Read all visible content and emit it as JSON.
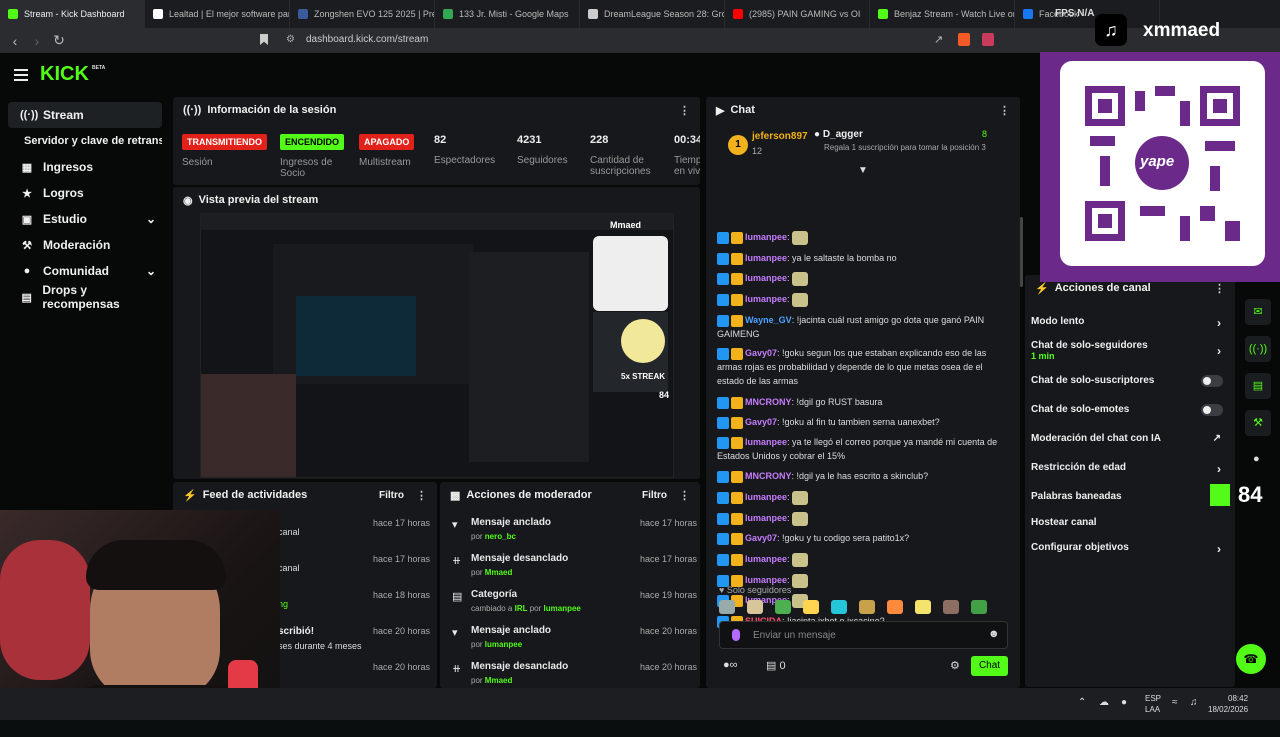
{
  "browser": {
    "tabs": [
      {
        "label": "Stream - Kick Dashboard",
        "color": "#53fc18"
      },
      {
        "label": "Lealtad | El mejor software para",
        "color": "#ffffff"
      },
      {
        "label": "Zongshen EVO 125 2025 | Prec",
        "color": "#3a5a9a"
      },
      {
        "label": "133 Jr. Misti - Google Maps",
        "color": "#34a853"
      },
      {
        "label": "DreamLeague Season 28: Grou",
        "color": "#cccccc"
      },
      {
        "label": "(2985) PAIN GAMING vs OI",
        "color": "#ff0000"
      },
      {
        "label": "Benjaz Stream - Watch Live on",
        "color": "#53fc18"
      },
      {
        "label": "Facebook",
        "color": "#1877f2"
      }
    ],
    "url": "dashboard.kick.com/stream",
    "fps": "FPS",
    "fps_val": "N/A"
  },
  "overlay": {
    "tiktok_name": "xmmaed",
    "yape": "yape",
    "kick_badge": "84"
  },
  "sidebar": {
    "logo": "KICK",
    "beta": "BETA",
    "items": [
      {
        "label": "Stream",
        "icon": "stream-icon"
      },
      {
        "label": "Servidor y clave de retransmisión",
        "icon": ""
      },
      {
        "label": "Ingresos",
        "icon": "money-icon"
      },
      {
        "label": "Logros",
        "icon": "trophy-icon"
      },
      {
        "label": "Estudio",
        "icon": "studio-icon"
      },
      {
        "label": "Moderación",
        "icon": "wrench-icon"
      },
      {
        "label": "Comunidad",
        "icon": "people-icon"
      },
      {
        "label": "Drops y recompensas",
        "icon": "gift-icon"
      }
    ]
  },
  "session": {
    "title": "Información de la sesión",
    "badges": [
      {
        "label": "TRANSMITIENDO",
        "sub": "Sesión",
        "bg": "#e1211a",
        "fg": "#ffffff"
      },
      {
        "label": "ENCENDIDO",
        "sub": "Ingresos de Socio",
        "bg": "#53fc18",
        "fg": "#000000"
      },
      {
        "label": "APAGADO",
        "sub": "Multistream",
        "bg": "#e1211a",
        "fg": "#ffffff"
      }
    ],
    "stats": [
      {
        "value": "82",
        "label": "Espectadores"
      },
      {
        "value": "4231",
        "label": "Seguidores"
      },
      {
        "value": "228",
        "label": "Cantidad de suscripciones"
      },
      {
        "value": "00:34:",
        "label": "Tiempo en vivo"
      }
    ]
  },
  "preview": {
    "title": "Vista previa del stream",
    "streak": "5x STREAK",
    "streak_name": "Mmaed",
    "streak_count": "84"
  },
  "feed": {
    "title": "Feed de actividades",
    "filter": "Filtro",
    "rows": [
      {
        "text": "canal",
        "time": "hace 17 horas"
      },
      {
        "text": "canal",
        "time": "hace 17 horas"
      },
      {
        "text": "ng",
        "time": "hace 18 horas"
      },
      {
        "text": "scribió!",
        "sub": "ses durante 4 meses",
        "time": "hace 20 horas"
      },
      {
        "text": "",
        "time": "hace 20 horas"
      }
    ]
  },
  "modactions": {
    "title": "Acciones de moderador",
    "filter": "Filtro",
    "rows": [
      {
        "title": "Mensaje anclado",
        "by": "por",
        "user": "nero_bc",
        "time": "hace 17 horas",
        "icon": "pin-icon"
      },
      {
        "title": "Mensaje desanclado",
        "by": "por",
        "user": "Mmaed",
        "time": "hace 17 horas",
        "icon": "unpin-icon"
      },
      {
        "title": "Categoría",
        "by": "cambiado a",
        "user": "IRL",
        "by2": "por",
        "user2": "lumanpee",
        "time": "hace 19 horas",
        "icon": "category-icon"
      },
      {
        "title": "Mensaje anclado",
        "by": "por",
        "user": "lumanpee",
        "time": "hace 20 horas",
        "icon": "pin-icon"
      },
      {
        "title": "Mensaje desanclado",
        "by": "por",
        "user": "Mmaed",
        "time": "hace 20 horas",
        "icon": "unpin-icon"
      }
    ]
  },
  "chat": {
    "title": "Chat",
    "top_user": "jeferson897",
    "top_rank": "1",
    "top_count": "12",
    "gifter": "D_agger",
    "gifter_count": "8",
    "gifter_msg": "Regala 1 suscripción para tomar la posición 3",
    "messages": [
      {
        "user": "lumanpee",
        "color": "#c77dff",
        "text": "",
        "emote": true
      },
      {
        "user": "lumanpee",
        "color": "#c77dff",
        "text": "ya le saltaste la bomba no"
      },
      {
        "user": "lumanpee",
        "color": "#c77dff",
        "text": "",
        "emote": true
      },
      {
        "user": "lumanpee",
        "color": "#c77dff",
        "text": "",
        "emote": true
      },
      {
        "user": "Wayne_GV",
        "color": "#4aa3ff",
        "text": "!jacinta cuál rust amigo go dota que ganó PAIN GAIMENG"
      },
      {
        "user": "Gavy07",
        "color": "#c77dff",
        "text": "!goku segun los que estaban explicando eso de las armas rojas es probabilidad y depende de lo que metas osea de el estado de las armas"
      },
      {
        "user": "MNCRONY",
        "color": "#c77dff",
        "text": "!dgil go RUST basura"
      },
      {
        "user": "Gavy07",
        "color": "#c77dff",
        "text": "!goku al fin tu tambien serna uanexbet?"
      },
      {
        "user": "lumanpee",
        "color": "#c77dff",
        "text": "ya te llegó el correo porque ya mandé mi cuenta de Estados Unidos y cobrar el 15%"
      },
      {
        "user": "MNCRONY",
        "color": "#c77dff",
        "text": "!dgil ya le has escrito a skinclub?"
      },
      {
        "user": "lumanpee",
        "color": "#c77dff",
        "text": "",
        "emote": true
      },
      {
        "user": "lumanpee",
        "color": "#c77dff",
        "text": "",
        "emote": true
      },
      {
        "user": "Gavy07",
        "color": "#c77dff",
        "text": "!goku y tu codigo sera patito1x?"
      },
      {
        "user": "lumanpee",
        "color": "#c77dff",
        "text": "",
        "emote": true
      },
      {
        "user": "lumanpee",
        "color": "#c77dff",
        "text": "",
        "emote": true
      },
      {
        "user": "lumanpee",
        "color": "#c77dff",
        "text": "",
        "emote": true
      },
      {
        "user": "SUICIDA",
        "color": "#ff4d6d",
        "text": "!jacinta ixbet o ixcacino?"
      }
    ],
    "followers_only": "Solo seguidores",
    "input_placeholder": "Enviar un mensaje",
    "points": "0",
    "send": "Chat"
  },
  "channel_actions": {
    "title": "Acciones de canal",
    "rows": [
      {
        "label": "Modo lento",
        "type": "arrow"
      },
      {
        "label": "Chat de solo-seguidores",
        "sub": "1 min",
        "type": "arrow"
      },
      {
        "label": "Chat de solo-suscriptores",
        "type": "toggle"
      },
      {
        "label": "Chat de solo-emotes",
        "type": "toggle"
      },
      {
        "label": "Moderación del chat con IA",
        "type": "external"
      },
      {
        "label": "Restricción de edad",
        "type": "arrow"
      },
      {
        "label": "Palabras baneadas",
        "type": "none"
      },
      {
        "label": "Hostear canal",
        "type": "none"
      },
      {
        "label": "Configurar objetivos",
        "type": "arrow"
      }
    ]
  },
  "taskbar": {
    "lang1": "ESP",
    "lang2": "LAA",
    "time": "08:42",
    "date": "18/02/2026"
  }
}
